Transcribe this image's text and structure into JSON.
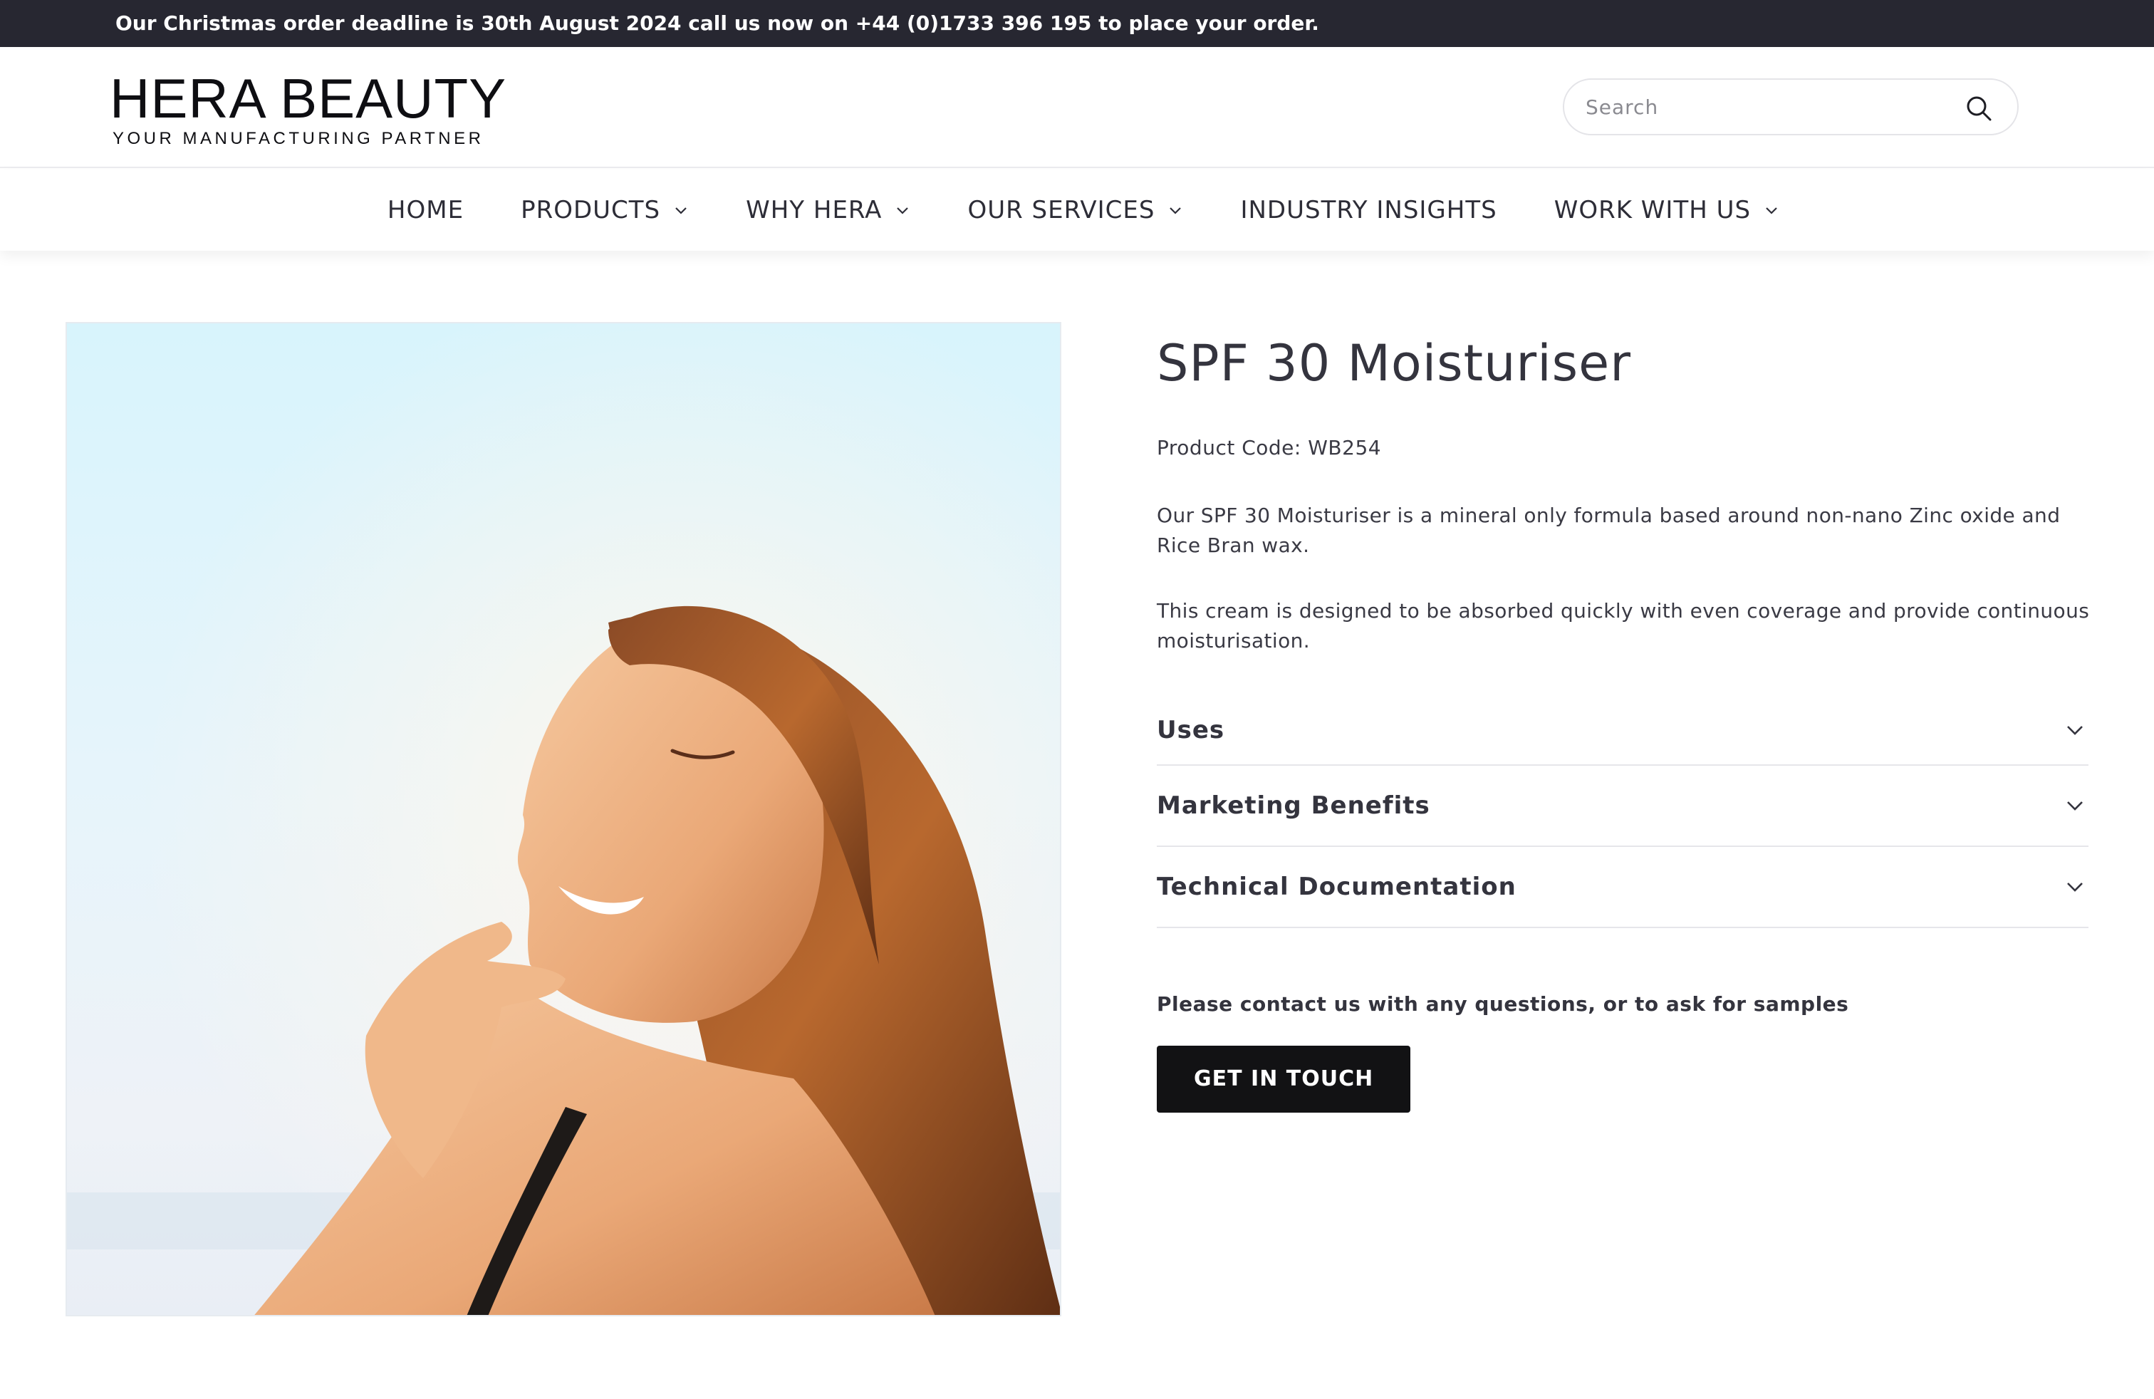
{
  "announcement": "Our Christmas order deadline is 30th August 2024 call us now on +44 (0)1733 396 195 to place your order.",
  "brand": {
    "name": "HERA BEAUTY",
    "tagline": "YOUR MANUFACTURING PARTNER"
  },
  "search": {
    "placeholder": "Search",
    "icon": "search-icon"
  },
  "nav": {
    "items": [
      {
        "label": "HOME",
        "dropdown": false
      },
      {
        "label": "PRODUCTS",
        "dropdown": true
      },
      {
        "label": "WHY HERA",
        "dropdown": true
      },
      {
        "label": "OUR SERVICES",
        "dropdown": true
      },
      {
        "label": "INDUSTRY INSIGHTS",
        "dropdown": false
      },
      {
        "label": "WORK WITH US",
        "dropdown": true
      }
    ]
  },
  "product": {
    "title": "SPF 30 Moisturiser",
    "code": "Product Code: WB254",
    "description_1": "Our SPF 30 Moisturiser is a mineral only formula based around non-nano Zinc oxide and Rice Bran wax.",
    "description_2": "This cream is designed to be absorbed quickly with even coverage and provide continuous moisturisation.",
    "accordion": [
      {
        "label": "Uses"
      },
      {
        "label": "Marketing Benefits"
      },
      {
        "label": "Technical Documentation"
      }
    ],
    "contact_text": "Please contact us with any questions, or to ask for samples",
    "cta_label": "GET IN TOUCH"
  },
  "colors": {
    "announcement_bg": "#272731",
    "button_bg": "#121214",
    "text": "#34343e"
  }
}
